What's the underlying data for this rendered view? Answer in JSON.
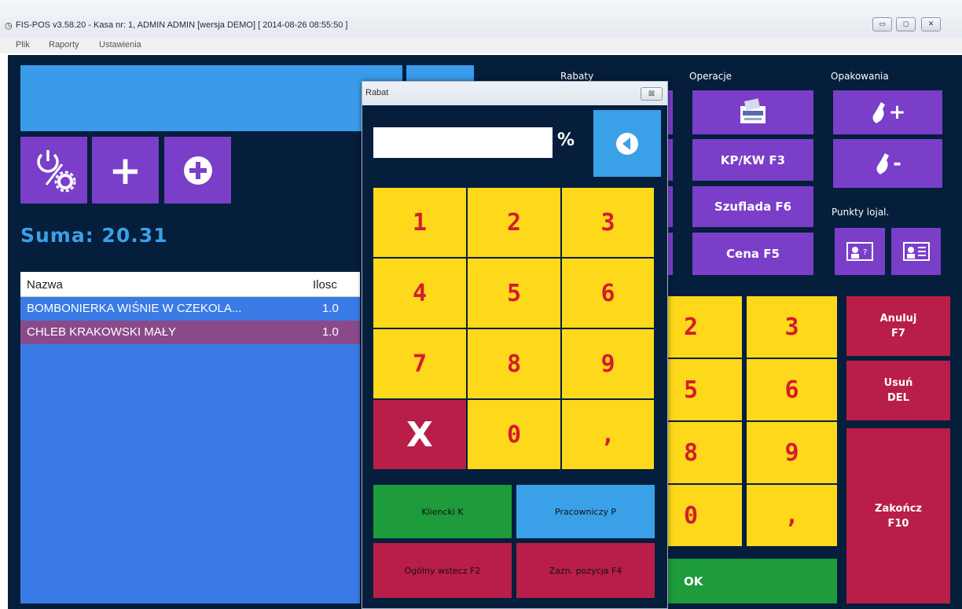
{
  "window": {
    "title": "FIS-POS v3.58.20 - Kasa nr: 1, ADMIN ADMIN [wersja DEMO]  [ 2014-08-26 08:55:50 ]",
    "minimize": "▭",
    "maximize": "◻",
    "close": "✕"
  },
  "menu": [
    "Plik",
    "Raporty",
    "Ustawienia"
  ],
  "toolbar": {
    "settings_icon": "power-settings-icon",
    "plus_icon": "+",
    "add_icon": "⊕"
  },
  "sum": {
    "text": "Suma: 20.31"
  },
  "list": {
    "col_name": "Nazwa",
    "col_qty": "Ilosc",
    "rows": [
      {
        "name": "BOMBONIERKA WIŚNIE W CZEKOLA...",
        "qty": "1.0"
      },
      {
        "name": "CHLEB KRAKOWSKI MAŁY",
        "qty": "1.0"
      }
    ]
  },
  "sections": {
    "rabaty": "Rabaty",
    "operacje": "Operacje",
    "opakowania": "Opakowania",
    "punkty": "Punkty lojal."
  },
  "operations": {
    "kpkw": "KP/KW F3",
    "szuflada": "Szuflada F6",
    "cena": "Cena F5"
  },
  "packaging": {
    "plus": "+",
    "minus": "-"
  },
  "right_actions": {
    "anuluj": "Anuluj\nF7",
    "usun": "Usuń\nDEL",
    "zakoncz": "Zakończ\nF10",
    "ok": "OK"
  },
  "bg_keypad": [
    "2",
    "3",
    "5",
    "6",
    "8",
    "9",
    "0",
    ","
  ],
  "dialog": {
    "title": "Rabat",
    "close": "⊠",
    "percent": "%",
    "keys": [
      "1",
      "2",
      "3",
      "4",
      "5",
      "6",
      "7",
      "8",
      "9",
      "X",
      "0",
      ","
    ],
    "klient": "Kliencki K",
    "pracowniczy": "Pracowniczy P",
    "ogolny": "Ogólny wstecz F2",
    "pozycja": "Zazn. pozycja F4"
  },
  "colors": {
    "bg": "#051e3c",
    "blue": "#3aa0e8",
    "purple": "#7a3ec9",
    "red": "#b81e48",
    "yellow": "#fdd81b",
    "green": "#1e9b3a"
  }
}
